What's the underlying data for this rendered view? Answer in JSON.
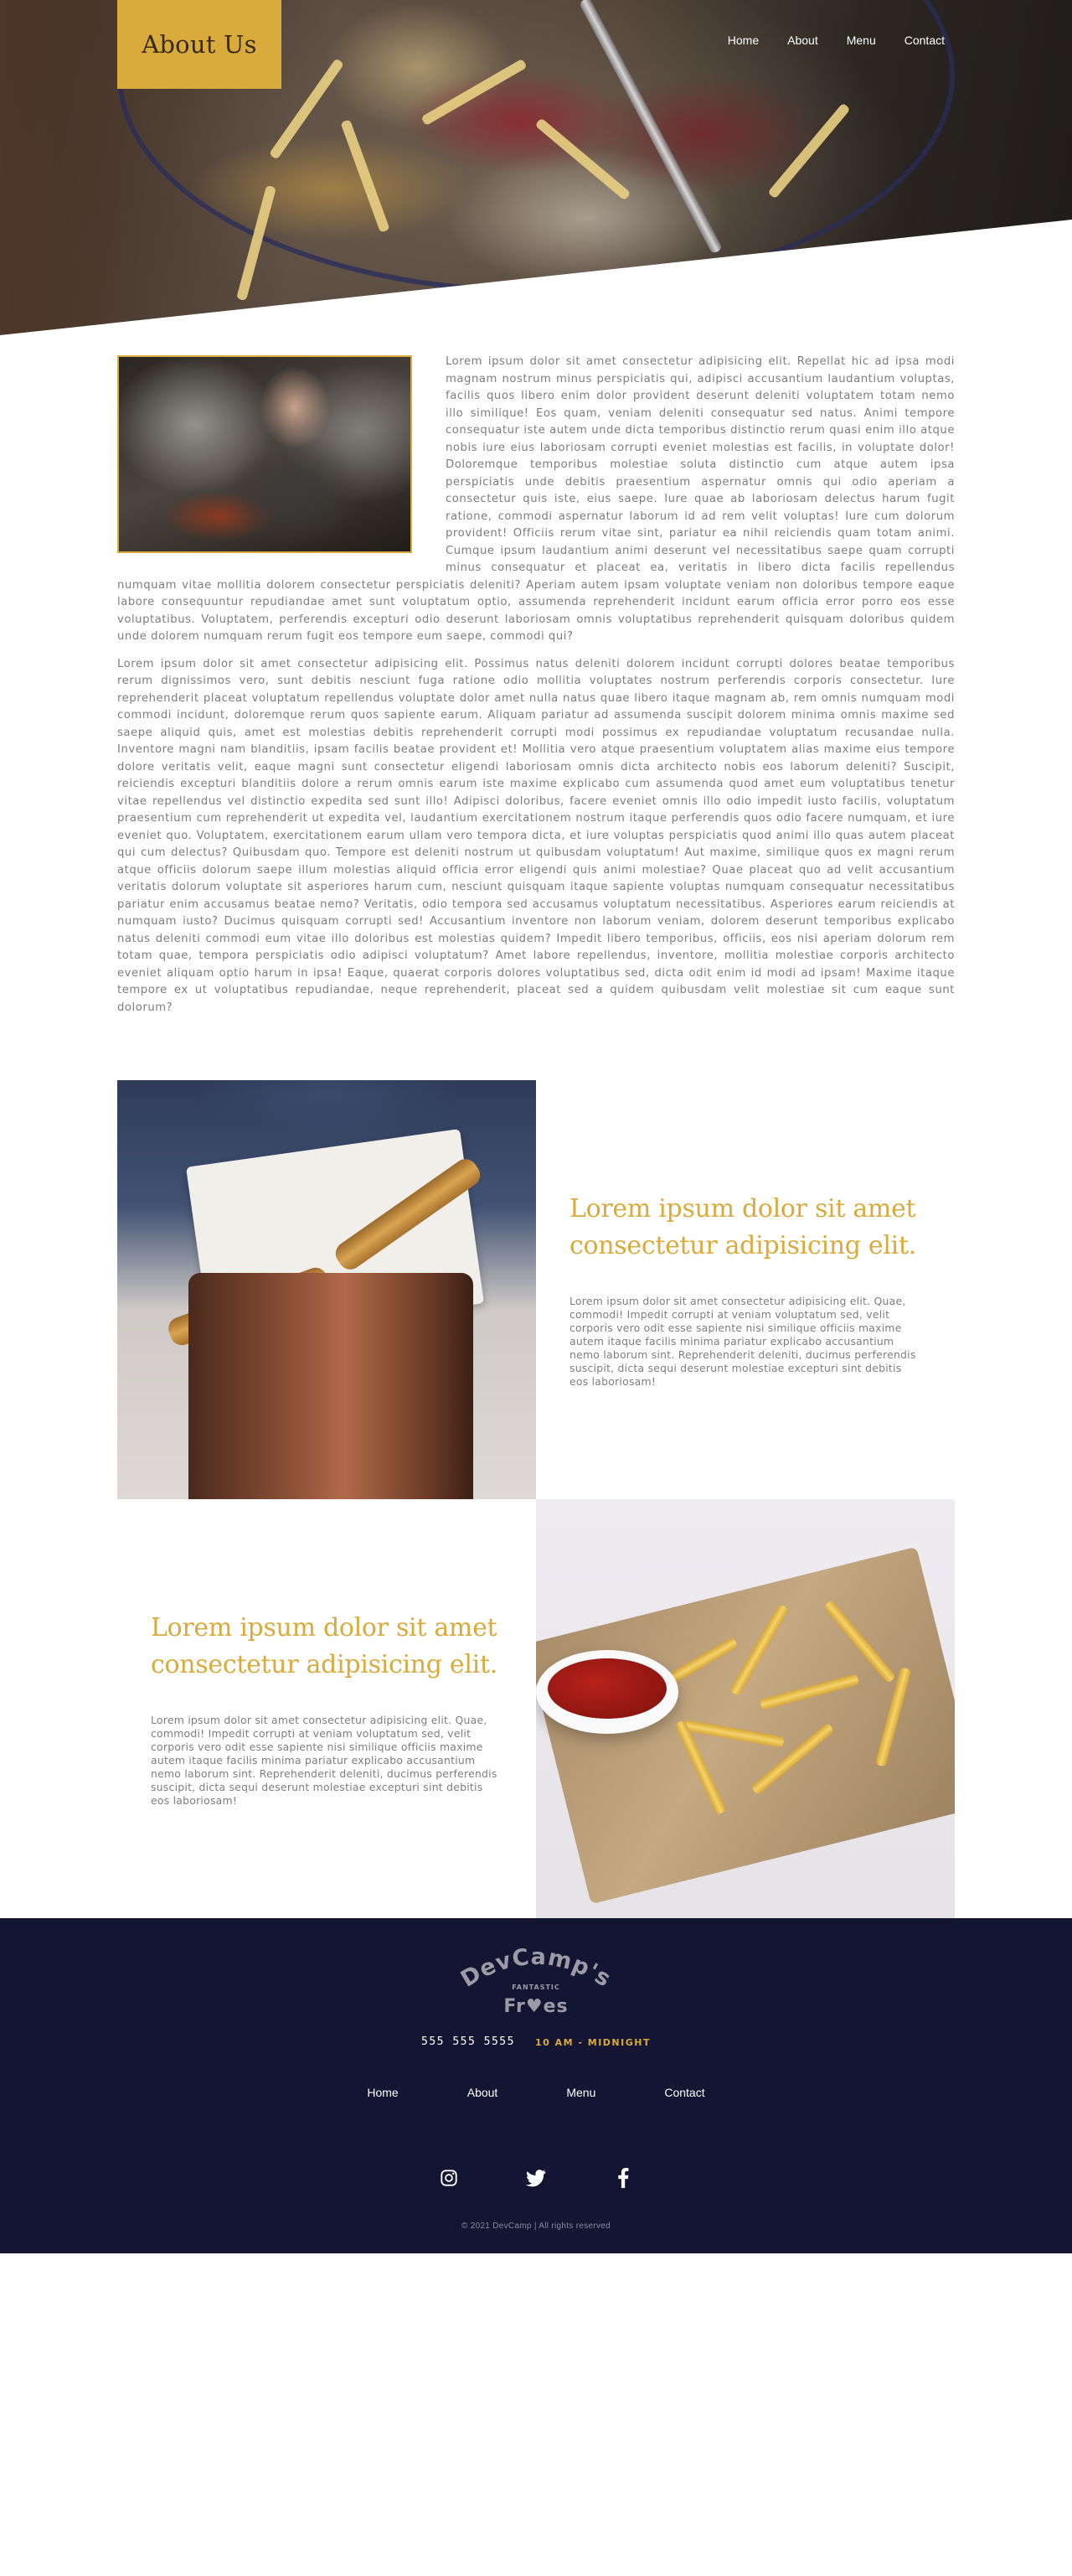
{
  "header": {
    "title": "About Us",
    "nav": [
      "Home",
      "About",
      "Menu",
      "Contact"
    ]
  },
  "article": {
    "paragraphs": [
      "Lorem ipsum dolor sit amet consectetur adipisicing elit. Repellat hic ad ipsa modi magnam nostrum minus perspiciatis qui, adipisci accusantium laudantium voluptas, facilis quos libero enim dolor provident deserunt deleniti voluptatem totam nemo illo similique! Eos quam, veniam deleniti consequatur sed natus. Animi tempore consequatur iste autem unde dicta temporibus distinctio rerum quasi enim illo atque nobis iure eius laboriosam corrupti eveniet molestias est facilis, in voluptate dolor! Doloremque temporibus molestiae soluta distinctio cum atque autem ipsa perspiciatis unde debitis praesentium aspernatur omnis qui odio aperiam a consectetur quis iste, eius saepe. Iure quae ab laboriosam delectus harum fugit ratione, commodi aspernatur laborum id ad rem velit voluptas! Iure cum dolorum provident! Officiis rerum vitae sint, pariatur ea nihil reiciendis quam totam animi. Cumque ipsum laudantium animi deserunt vel necessitatibus saepe quam corrupti minus consequatur et placeat ea, veritatis in libero dicta facilis repellendus numquam vitae mollitia dolorem consectetur perspiciatis deleniti? Aperiam autem ipsam voluptate veniam non doloribus tempore eaque labore consequuntur repudiandae amet sunt voluptatum optio, assumenda reprehenderit incidunt earum officia error porro eos esse voluptatibus. Voluptatem, perferendis excepturi odio deserunt laboriosam omnis voluptatibus reprehenderit quisquam doloribus quidem unde dolorem numquam rerum fugit eos tempore eum saepe, commodi qui?",
      "Lorem ipsum dolor sit amet consectetur adipisicing elit. Possimus natus deleniti dolorem incidunt corrupti dolores beatae temporibus rerum dignissimos vero, sunt debitis nesciunt fuga ratione odio mollitia voluptates nostrum perferendis corporis consectetur. Iure reprehenderit placeat voluptatum repellendus voluptate dolor amet nulla natus quae libero itaque magnam ab, rem omnis numquam modi commodi incidunt, doloremque rerum quos sapiente earum. Aliquam pariatur ad assumenda suscipit dolorem minima omnis maxime sed saepe aliquid quis, amet est molestias debitis reprehenderit corrupti modi possimus ex repudiandae voluptatum recusandae nulla. Inventore magni nam blanditiis, ipsam facilis beatae provident et! Mollitia vero atque praesentium voluptatem alias maxime eius tempore dolore veritatis velit, eaque magni sunt consectetur eligendi laboriosam omnis dicta architecto nobis eos laborum deleniti? Suscipit, reiciendis excepturi blanditiis dolore a rerum omnis earum iste maxime explicabo cum assumenda quod amet eum voluptatibus tenetur vitae repellendus vel distinctio expedita sed sunt illo! Adipisci doloribus, facere eveniet omnis illo odio impedit iusto facilis, voluptatum praesentium cum reprehenderit ut expedita vel, laudantium exercitationem nostrum itaque perferendis quos odio facere numquam, et iure eveniet quo. Voluptatem, exercitationem earum ullam vero tempora dicta, et iure voluptas perspiciatis quod animi illo quas autem placeat qui cum delectus? Quibusdam quo. Tempore est deleniti nostrum ut quibusdam voluptatum! Aut maxime, similique quos ex magni rerum atque officiis dolorum saepe illum molestias aliquid officia error eligendi quis animi molestiae? Quae placeat quo ad velit accusantium veritatis dolorum voluptate sit asperiores harum cum, nesciunt quisquam itaque sapiente voluptas numquam consequatur necessitatibus pariatur enim accusamus beatae nemo? Veritatis, odio tempora sed accusamus voluptatum necessitatibus. Asperiores earum reiciendis at numquam iusto? Ducimus quisquam corrupti sed! Accusantium inventore non laborum veniam, dolorem deserunt temporibus explicabo natus deleniti commodi eum vitae illo doloribus est molestias quidem? Impedit libero temporibus, officiis, eos nisi aperiam dolorum rem totam quae, tempora perspiciatis odio adipisci voluptatum? Amet labore repellendus, inventore, mollitia molestiae corporis architecto eveniet aliquam optio harum in ipsa! Eaque, quaerat corporis dolores voluptatibus sed, dicta odit enim id modi ad ipsam! Maxime itaque tempore ex ut voluptatibus repudiandae, neque reprehenderit, placeat sed a quidem quibusdam velit molestiae sit cum eaque sunt dolorum?"
    ]
  },
  "features": [
    {
      "heading": "Lorem ipsum dolor sit amet consectetur adipisicing elit.",
      "body": "Lorem ipsum dolor sit amet consectetur adipisicing elit. Quae, commodi! Impedit corrupti at veniam voluptatum sed, velit corporis vero odit esse sapiente nisi similique officiis maxime autem itaque facilis minima pariatur explicabo accusantium nemo laborum sint. Reprehenderit deleniti, ducimus perferendis suscipit, dicta sequi deserunt molestiae excepturi sint debitis eos laboriosam!"
    },
    {
      "heading": "Lorem ipsum dolor sit amet consectetur adipisicing elit.",
      "body": "Lorem ipsum dolor sit amet consectetur adipisicing elit. Quae, commodi! Impedit corrupti at veniam voluptatum sed, velit corporis vero odit esse sapiente nisi similique officiis maxime autem itaque facilis minima pariatur explicabo accusantium nemo laborum sint. Reprehenderit deleniti, ducimus perferendis suscipit, dicta sequi deserunt molestiae excepturi sint debitis eos laboriosam!"
    }
  ],
  "footer": {
    "logo": {
      "top": "DevCamp's",
      "middle": "FANTASTIC",
      "bottom": "Fr♥es"
    },
    "phone": "555 555 5555",
    "hours": "10 AM - MIDNIGHT",
    "nav": [
      "Home",
      "About",
      "Menu",
      "Contact"
    ],
    "socials": [
      "instagram-icon",
      "twitter-icon",
      "facebook-icon"
    ],
    "copyright": "© 2021 DevCamp | All rights reserved"
  },
  "colors": {
    "accent": "#d9aa3c",
    "footer_bg": "#131533",
    "body_text": "#7d7d7d"
  }
}
